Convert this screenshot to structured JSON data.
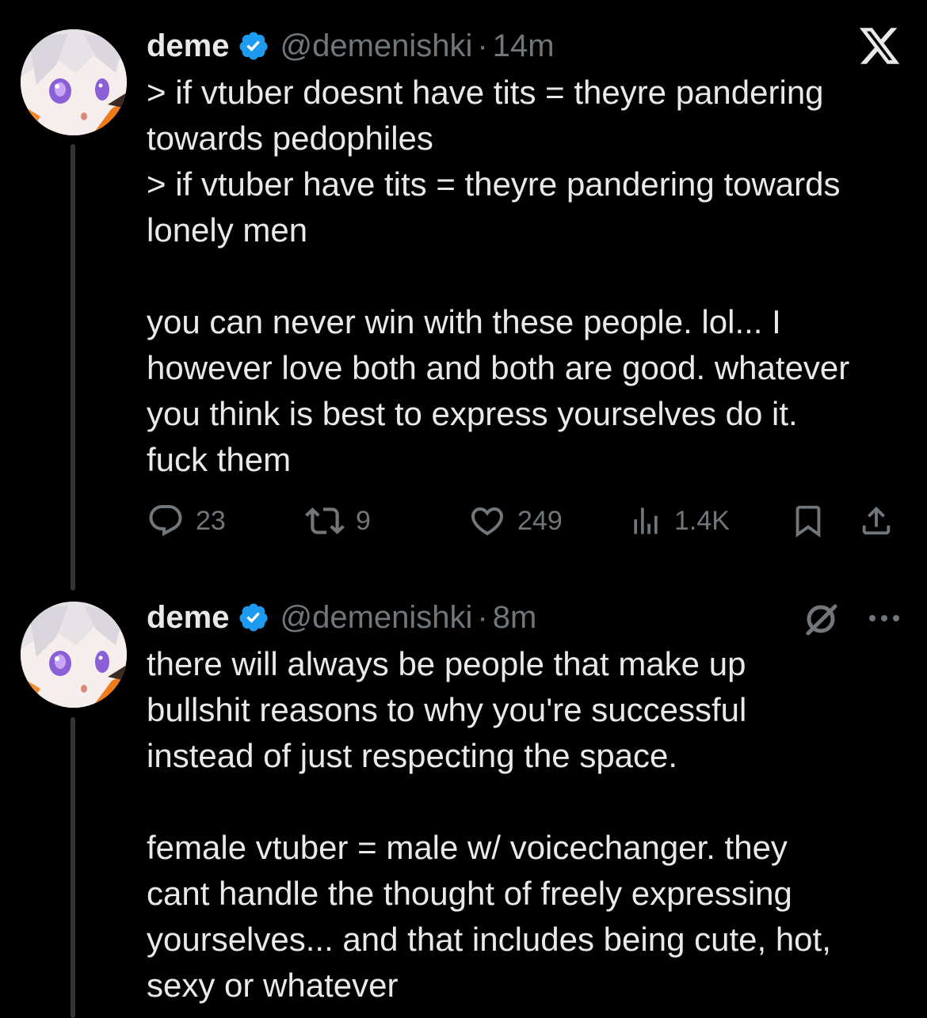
{
  "colors": {
    "background": "#000000",
    "primary_text": "#e7e9ea",
    "secondary_text": "#71767b",
    "verified_badge": "#1d9bf0",
    "thread_line": "#333639"
  },
  "tweets": [
    {
      "author": {
        "display_name": "deme",
        "handle": "@demenishki",
        "verified": true,
        "avatar_icon": "avatar-anime-girl"
      },
      "separator": "·",
      "time": "14m",
      "body_lines": [
        "> if vtuber doesnt have tits = theyre pandering",
        "towards pedophiles",
        "> if vtuber have tits = theyre pandering towards",
        "lonely men",
        "",
        "you can never win with these people. lol... I",
        "however love both and both are good. whatever",
        "you think is best to express yourselves do it.",
        "fuck them"
      ],
      "metrics": {
        "replies": "23",
        "reposts": "9",
        "likes": "249",
        "views": "1.4K"
      }
    },
    {
      "author": {
        "display_name": "deme",
        "handle": "@demenishki",
        "verified": true,
        "avatar_icon": "avatar-anime-girl"
      },
      "separator": "·",
      "time": "8m",
      "body_lines": [
        "there will always be people that make up",
        "bullshit reasons to why you're successful",
        "instead of just respecting the space.",
        "",
        "female vtuber = male w/ voicechanger. they",
        "cant handle the thought of freely expressing",
        "yourselves... and that includes being cute, hot,",
        "sexy or whatever"
      ]
    }
  ]
}
